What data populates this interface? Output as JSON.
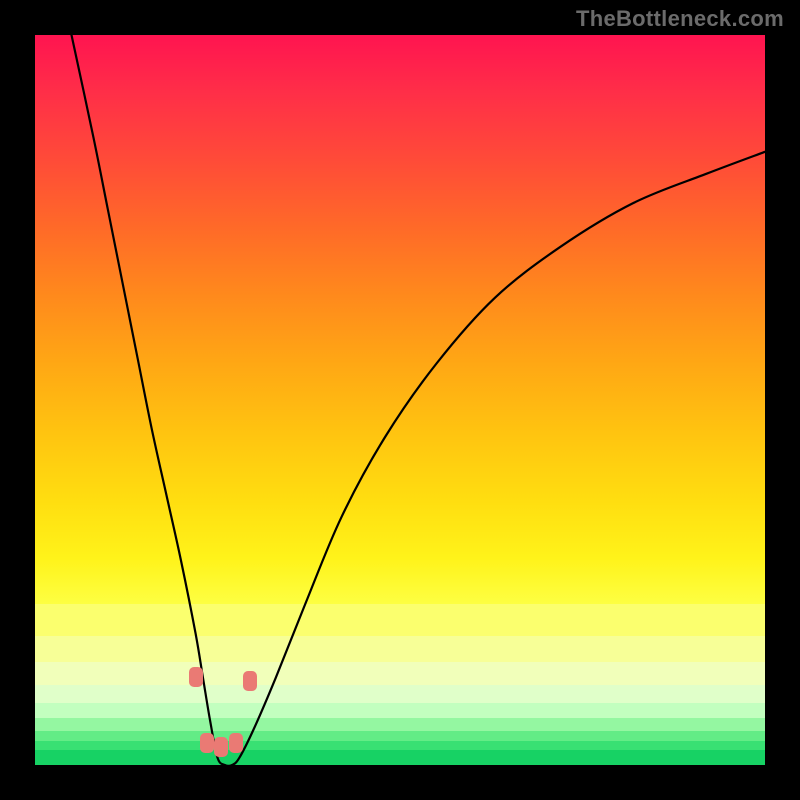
{
  "watermark": "TheBottleneck.com",
  "colors": {
    "frame": "#000000",
    "curve": "#000000",
    "marker": "#ea7a74",
    "watermark": "#6b6b6b"
  },
  "chart_data": {
    "type": "line",
    "title": "",
    "xlabel": "",
    "ylabel": "",
    "xlim": [
      0,
      100
    ],
    "ylim": [
      0,
      100
    ],
    "grid": false,
    "legend": false,
    "note": "V-shaped bottleneck curve over rainbow gradient. Axes are unlabeled; values are estimated percentages of plot width/height. y=0 is the bottom green band; y=100 is the top edge.",
    "series": [
      {
        "name": "bottleneck-curve",
        "x": [
          5,
          8,
          10,
          12,
          14,
          16,
          18,
          20,
          22,
          23,
          24,
          25,
          26,
          27,
          28,
          30,
          33,
          37,
          42,
          48,
          55,
          63,
          72,
          82,
          92,
          100
        ],
        "y": [
          100,
          86,
          76,
          66,
          56,
          46,
          37,
          28,
          18,
          12,
          6,
          1,
          0,
          0,
          1,
          5,
          12,
          22,
          34,
          45,
          55,
          64,
          71,
          77,
          81,
          84
        ]
      }
    ],
    "markers": {
      "note": "Salmon rounded markers near curve minimum; positions in same percentage space as series.",
      "points": [
        {
          "x": 22.0,
          "y": 12.0
        },
        {
          "x": 23.5,
          "y": 3.0
        },
        {
          "x": 25.5,
          "y": 2.5
        },
        {
          "x": 27.5,
          "y": 3.0
        },
        {
          "x": 29.5,
          "y": 11.5
        }
      ]
    },
    "background_gradient": {
      "note": "Vertical gradient from red (top, high bottleneck) through orange/yellow to green (bottom, low bottleneck). Stops given as [percent_from_top, hex].",
      "stops_main": [
        [
          0,
          "#ff1450"
        ],
        [
          10,
          "#ff2e48"
        ],
        [
          22,
          "#ff4b38"
        ],
        [
          34,
          "#ff6a28"
        ],
        [
          46,
          "#ff8a1c"
        ],
        [
          58,
          "#ffa814"
        ],
        [
          70,
          "#ffc410"
        ],
        [
          82,
          "#ffde10"
        ],
        [
          92,
          "#fff31a"
        ],
        [
          100,
          "#fdff42"
        ]
      ],
      "bottom_bands": [
        {
          "top_pct": 78.0,
          "height_pct": 4.3,
          "color": "#fbff6e"
        },
        {
          "top_pct": 82.3,
          "height_pct": 3.6,
          "color": "#f7ff97"
        },
        {
          "top_pct": 85.9,
          "height_pct": 3.1,
          "color": "#f1ffba"
        },
        {
          "top_pct": 89.0,
          "height_pct": 2.5,
          "color": "#e0ffc9"
        },
        {
          "top_pct": 91.5,
          "height_pct": 2.1,
          "color": "#c2ffbf"
        },
        {
          "top_pct": 93.6,
          "height_pct": 1.7,
          "color": "#94f7a1"
        },
        {
          "top_pct": 95.3,
          "height_pct": 1.4,
          "color": "#63ec86"
        },
        {
          "top_pct": 96.7,
          "height_pct": 1.2,
          "color": "#39e073"
        },
        {
          "top_pct": 97.9,
          "height_pct": 2.1,
          "color": "#17d264"
        }
      ]
    }
  }
}
